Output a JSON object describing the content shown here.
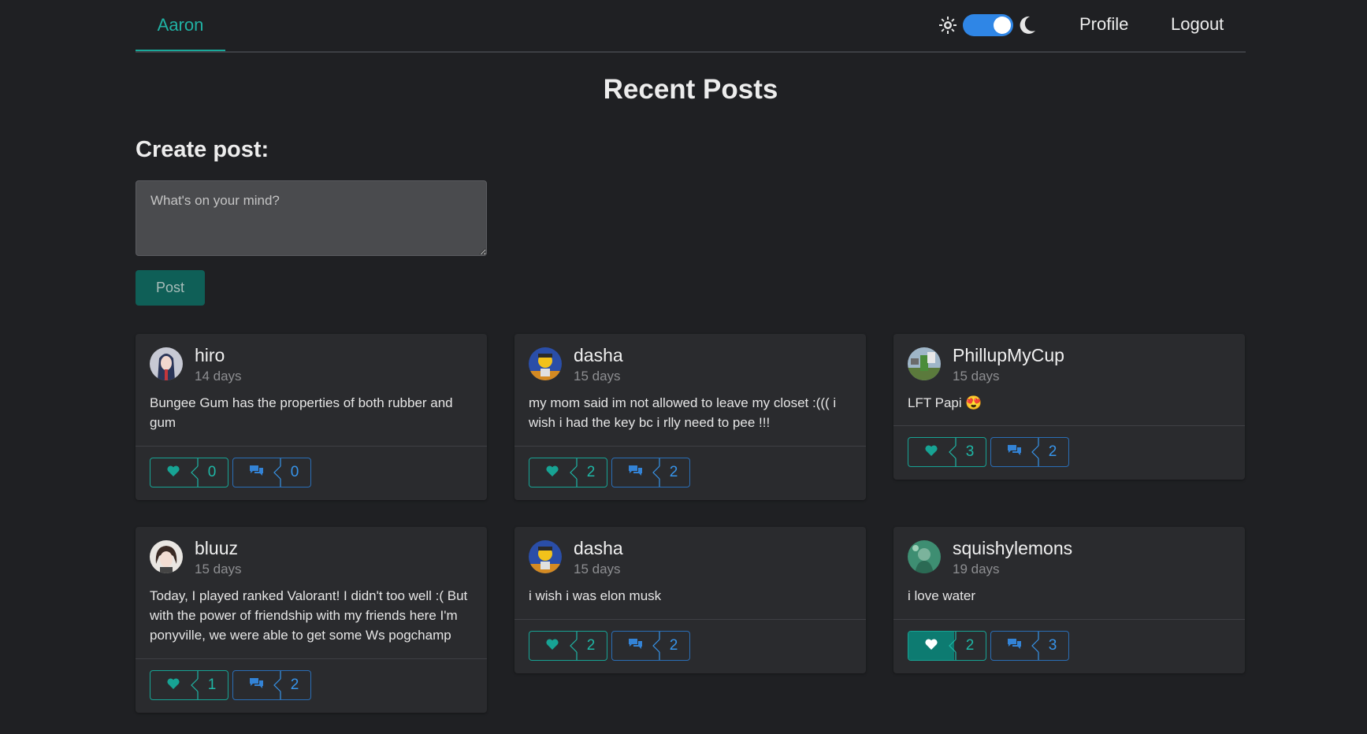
{
  "nav": {
    "brand": "Aaron",
    "profile_label": "Profile",
    "logout_label": "Logout",
    "theme": "dark",
    "toggle_icons": [
      "sun-icon",
      "moon-icon"
    ]
  },
  "page_title": "Recent Posts",
  "create_post": {
    "label": "Create post:",
    "placeholder": "What's on your mind?",
    "button_label": "Post"
  },
  "colors": {
    "background": "#1f2023",
    "card": "#2a2b2e",
    "accent": "#1aa89a",
    "like": "#17a394",
    "comment": "#2a6eb6",
    "toggle": "#2f86e6"
  },
  "posts": [
    {
      "username": "hiro",
      "time": "14 days",
      "text": "Bungee Gum has the properties of both rubber and gum",
      "likes": "0",
      "comments": "0",
      "liked": false
    },
    {
      "username": "dasha",
      "time": "15 days",
      "text": "my mom said im not allowed to leave my closet :((( i wish i had the key bc i rlly need to pee !!!",
      "likes": "2",
      "comments": "2",
      "liked": false
    },
    {
      "username": "PhillupMyCup",
      "time": "15 days",
      "text": "LFT Papi 😍",
      "likes": "3",
      "comments": "2",
      "liked": false
    },
    {
      "username": "bluuz",
      "time": "15 days",
      "text": "Today, I played ranked Valorant! I didn't too well :( But with the power of  friendship with my friends here I'm ponyville, we were able to get some Ws pogchamp",
      "likes": "1",
      "comments": "2",
      "liked": false
    },
    {
      "username": "dasha",
      "time": "15 days",
      "text": "i wish i was elon musk",
      "likes": "2",
      "comments": "2",
      "liked": false
    },
    {
      "username": "squishylemons",
      "time": "19 days",
      "text": "i love water",
      "likes": "2",
      "comments": "3",
      "liked": true
    }
  ]
}
